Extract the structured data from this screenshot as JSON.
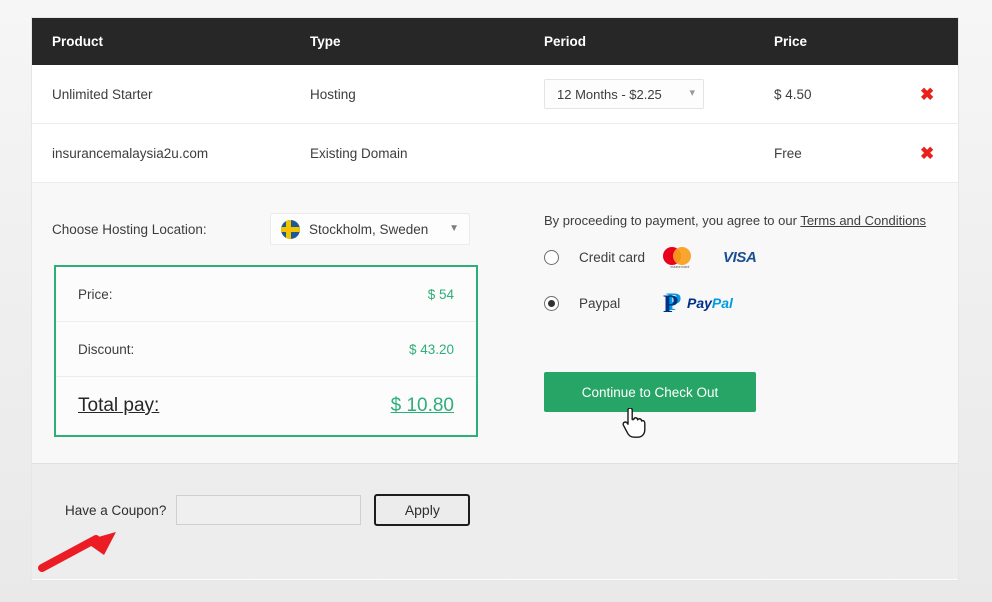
{
  "table": {
    "headers": [
      "Product",
      "Type",
      "Period",
      "Price",
      ""
    ],
    "rows": [
      {
        "product": "Unlimited Starter",
        "type": "Hosting",
        "period": "12 Months - $2.25",
        "price": "$ 4.50",
        "remove_icon": "remove-x-icon",
        "has_period_select": true
      },
      {
        "product": "insurancemalaysia2u.com",
        "type": "Existing Domain",
        "period": "",
        "price": "Free",
        "remove_icon": "remove-x-icon",
        "has_period_select": false
      }
    ]
  },
  "location": {
    "label": "Choose Hosting Location:",
    "selected": "Stockholm, Sweden",
    "flag_icon": "sweden-flag-icon",
    "caret_icon": "chevron-down-icon"
  },
  "summary": {
    "price_label": "Price:",
    "price_value": "$ 54",
    "discount_label": "Discount:",
    "discount_value": "$ 43.20",
    "total_label": "Total pay:",
    "total_value": "$ 10.80",
    "border_color": "#2eae78",
    "value_color": "#2eae78"
  },
  "payment": {
    "terms_prefix": "By proceeding to payment, you agree to our ",
    "terms_link": "Terms and Conditions",
    "options": [
      {
        "label": "Credit card",
        "selected": false,
        "logos": [
          "mastercard-logo",
          "visa-logo"
        ],
        "visa_text": "VISA",
        "mc_text": "mastercard"
      },
      {
        "label": "Paypal",
        "selected": true,
        "logos": [
          "paypal-logo"
        ],
        "paypal_pay": "Pay",
        "paypal_pal": "Pal"
      }
    ],
    "checkout_button": "Continue to Check Out",
    "button_color": "#27a567"
  },
  "coupon": {
    "label": "Have a Coupon?",
    "input_value": "",
    "input_placeholder": "",
    "apply_label": "Apply"
  },
  "annotations": {
    "arrow_color": "#ec1c24",
    "arrow_icon": "red-arrow-pointer",
    "cursor_icon": "hand-pointer-cursor"
  }
}
